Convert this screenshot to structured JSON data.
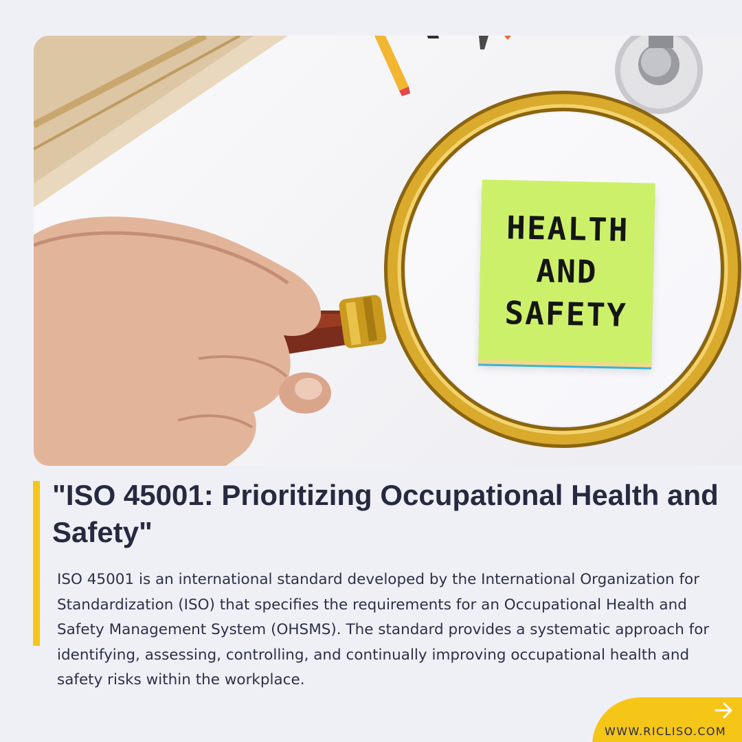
{
  "photo": {
    "note_lines": [
      "HEALTH",
      "AND",
      "SAFETY"
    ]
  },
  "title": "\"ISO 45001: Prioritizing Occupational Health and Safety\"",
  "description": "ISO 45001 is an international standard developed by the International Organization for Standardization (ISO) that specifies the requirements for an Occupational Health and Safety Management System (OHSMS). The standard provides a systematic approach for identifying, assessing, controlling, and continually improving occupational health and safety risks within the workplace.",
  "footer": {
    "website": "WWW.RICLISO.COM",
    "arrow_icon": "arrow-right-icon"
  },
  "colors": {
    "accent": "#f5c518",
    "text": "#262a40",
    "background": "#eff0f5",
    "note": "#cdf06a"
  }
}
